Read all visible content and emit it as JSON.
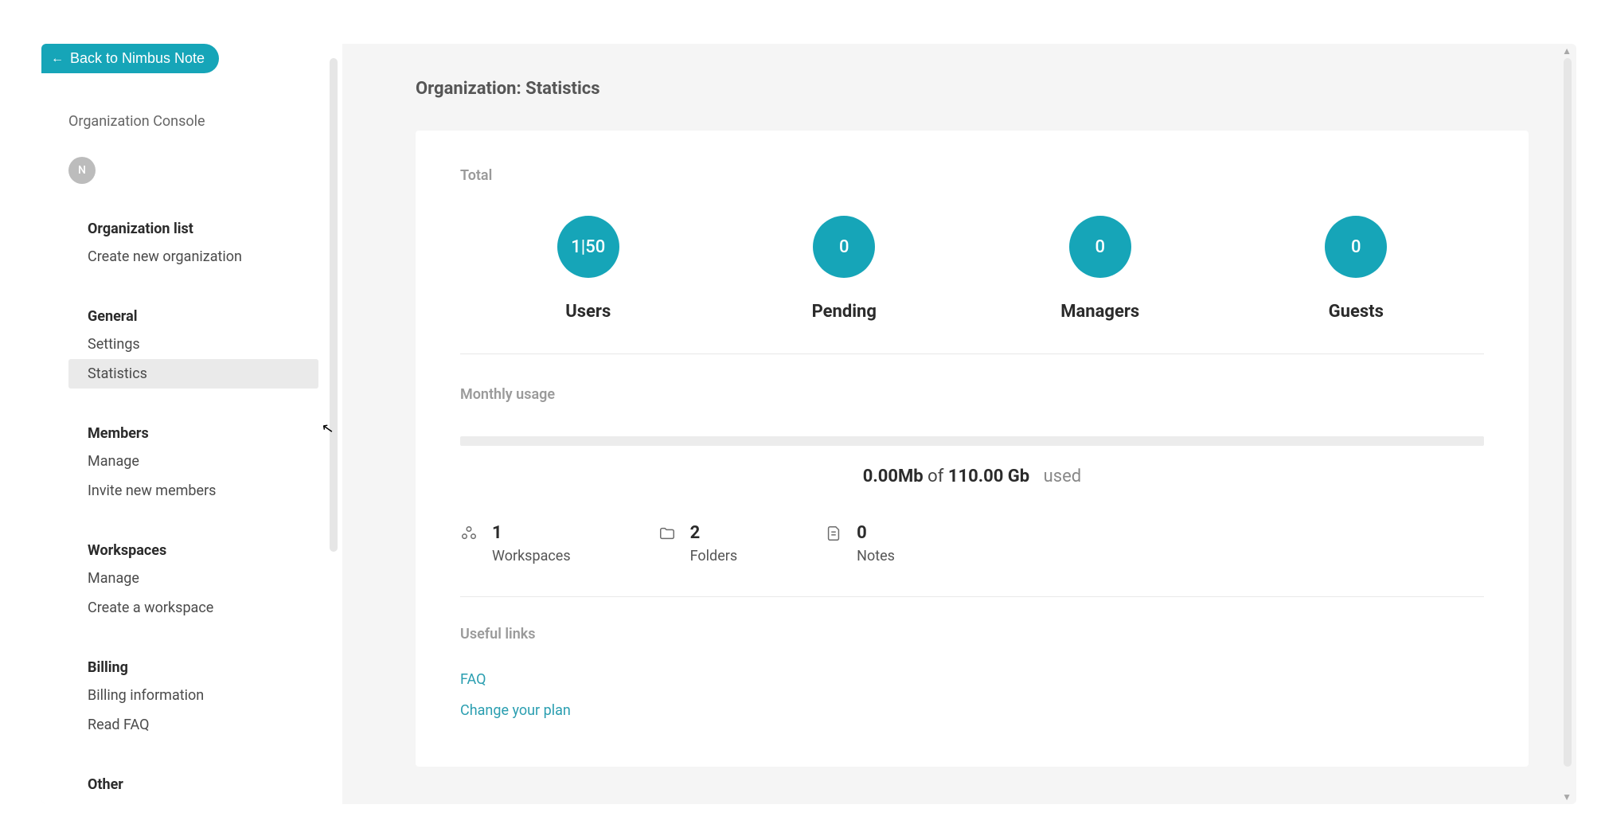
{
  "back_button": "Back to Nimbus Note",
  "console_label": "Organization Console",
  "avatar_letter": "N",
  "sections": {
    "org_list": {
      "header": "Organization list",
      "create": "Create new organization"
    },
    "general": {
      "header": "General",
      "settings": "Settings",
      "statistics": "Statistics"
    },
    "members": {
      "header": "Members",
      "manage": "Manage",
      "invite": "Invite new members"
    },
    "workspaces": {
      "header": "Workspaces",
      "manage": "Manage",
      "create": "Create a workspace"
    },
    "billing": {
      "header": "Billing",
      "info": "Billing information",
      "faq": "Read FAQ"
    },
    "other": {
      "header": "Other"
    }
  },
  "page_title": "Organization: Statistics",
  "total": {
    "label": "Total",
    "stats": {
      "users": {
        "value": "1|50",
        "label": "Users"
      },
      "pending": {
        "value": "0",
        "label": "Pending"
      },
      "managers": {
        "value": "0",
        "label": "Managers"
      },
      "guests": {
        "value": "0",
        "label": "Guests"
      }
    }
  },
  "usage": {
    "label": "Monthly usage",
    "used_val": "0.00Mb",
    "of": "of",
    "total_val": "110.00 Gb",
    "used_word": "used"
  },
  "counts": {
    "workspaces": {
      "num": "1",
      "label": "Workspaces"
    },
    "folders": {
      "num": "2",
      "label": "Folders"
    },
    "notes": {
      "num": "0",
      "label": "Notes"
    }
  },
  "links": {
    "label": "Useful links",
    "faq": "FAQ",
    "plan": "Change your plan"
  }
}
